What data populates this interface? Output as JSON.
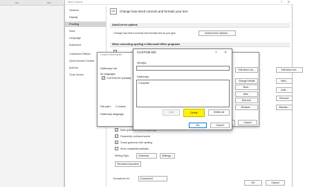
{
  "word_strip": {
    "label_a": "File",
    "label_b": "Find"
  },
  "options_window": {
    "title": "Word Options",
    "help_glyph": "?",
    "close_glyph": "✕",
    "nav": [
      "General",
      "Display",
      "Proofing",
      "Save",
      "Language",
      "Advanced",
      "Customize Ribbon",
      "Quick Access Toolbar",
      "Add-ins",
      "Trust Center"
    ],
    "active_nav_index": 2,
    "headline": "Change how Word corrects and formats your text",
    "abc_icon_text": "ABC",
    "autocorrect": {
      "section": "AutoCorrect options",
      "description": "Change how Word corrects and formats text as you type:",
      "button": "AutoCorrect Options..."
    },
    "ms_section": "When correcting spelling in Microsoft Office programs",
    "right_buttons": [
      "Edit Word List...",
      "New...",
      "Add...",
      "Remove",
      "Browse..."
    ],
    "lower_checks": [
      "Mark grammar errors as you type",
      "Frequently confused words",
      "Check grammar with spelling",
      "Show readability statistics"
    ],
    "writing_style_label": "Writing Style:",
    "writing_style_value": "Grammar",
    "settings_button": "Settings...",
    "recheck_button": "Recheck Document",
    "exceptions_label": "Exceptions for:",
    "exceptions_value": "Document1",
    "ok": "OK",
    "cancel": "Cancel"
  },
  "custom_dictionaries": {
    "title": "Custom Dictionaries",
    "list_label": "Dictionary List",
    "all_languages": "All Languages:",
    "entry": "CUSTOM.DIC (Default)",
    "file_path_label": "File path:",
    "file_path_value": "C:\\Users",
    "language_label": "Dictionary language:",
    "right_buttons": [
      "Edit Word List...",
      "Change Default",
      "New...",
      "Add...",
      "Remove",
      "Browse..."
    ],
    "ok": "OK",
    "cancel": "Cancel"
  },
  "custom_dic_dialog": {
    "title": "CUSTOM.DIC",
    "help_glyph": "?",
    "close_glyph": "✕",
    "word_label": "Word(s):",
    "word_value": "",
    "dictionary_label": "Dictionary:",
    "entries": [
      "Computer"
    ],
    "add_button": "Add",
    "delete_button": "Delete",
    "delete_all_button": "Delete all",
    "ok": "OK",
    "cancel": "Cancel"
  },
  "colors": {
    "highlight": "#fff200",
    "active_nav": "#d4d4d4",
    "focus_border": "#0078d7"
  }
}
